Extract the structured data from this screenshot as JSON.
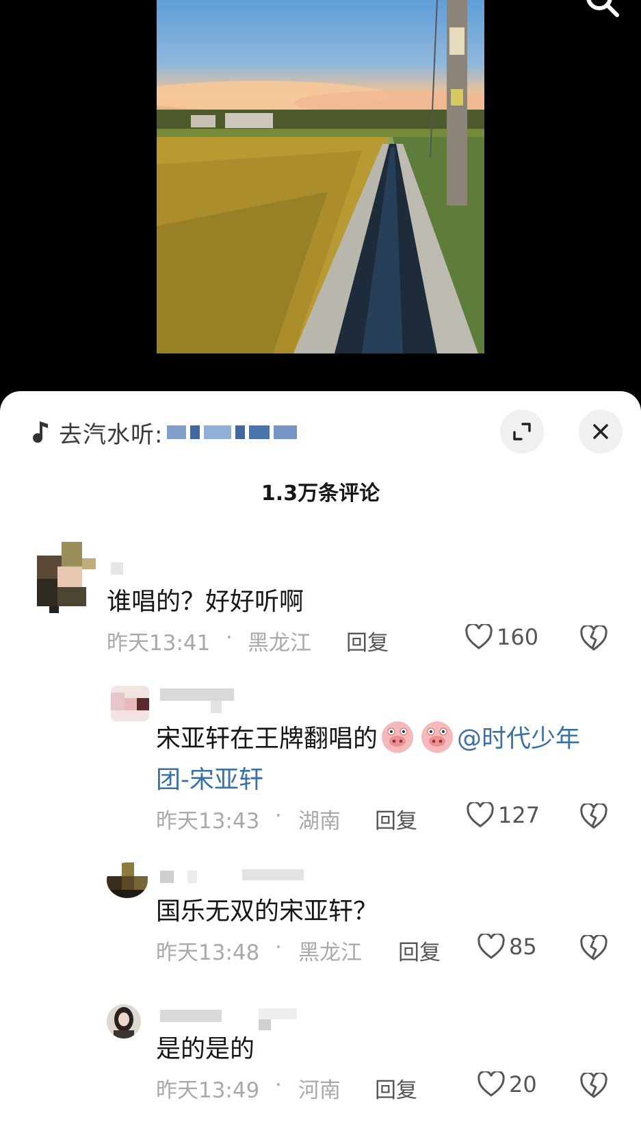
{
  "music": {
    "prefix": "去汽水听:"
  },
  "header": {
    "comment_count": "1.3万条评论"
  },
  "comments": [
    {
      "text": "谁唱的？好好听啊",
      "time": "昨天13:41",
      "location": "黑龙江",
      "reply_label": "回复",
      "likes": "160"
    },
    {
      "text_before": "宋亚轩在王牌翻唱的",
      "emoji": [
        "pig-face",
        "pig-face"
      ],
      "mention_line1": "@时代少年",
      "mention_line2": "团-宋亚轩",
      "time": "昨天13:43",
      "location": "湖南",
      "reply_label": "回复",
      "likes": "127"
    },
    {
      "text": "国乐无双的宋亚轩？",
      "time": "昨天13:48",
      "location": "黑龙江",
      "reply_label": "回复",
      "likes": "85"
    },
    {
      "text": "是的是的",
      "time": "昨天13:49",
      "location": "河南",
      "reply_label": "回复",
      "likes": "20"
    }
  ],
  "separator": "·",
  "colors": {
    "mention": "#3a6fa8",
    "sheet_bg": "#ffffff",
    "meta_text": "#a9a9a9"
  }
}
